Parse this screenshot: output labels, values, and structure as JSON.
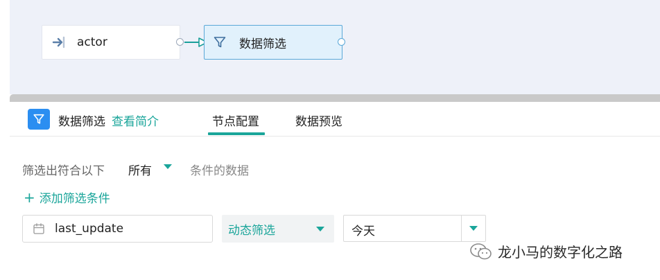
{
  "canvas": {
    "nodes": [
      {
        "label": "actor",
        "icon": "input-arrow-icon"
      },
      {
        "label": "数据筛选",
        "icon": "filter-icon"
      }
    ]
  },
  "panel": {
    "title": "数据筛选",
    "intro_link": "查看简介",
    "tabs": [
      {
        "label": "节点配置",
        "active": true
      },
      {
        "label": "数据预览",
        "active": false
      }
    ]
  },
  "filter": {
    "prefix": "筛选出符合以下",
    "match_mode": "所有",
    "suffix": "条件的数据",
    "add_condition": "添加筛选条件",
    "conditions": [
      {
        "field": "last_update",
        "mode": "动态筛选",
        "value": "今天"
      }
    ]
  },
  "watermark": {
    "text": "龙小马的数字化之路"
  },
  "colors": {
    "accent": "#1aa59a",
    "node_border": "#5aa8d8",
    "header_icon_bg": "#2b8ef1",
    "canvas_bg": "#eef1f9"
  }
}
